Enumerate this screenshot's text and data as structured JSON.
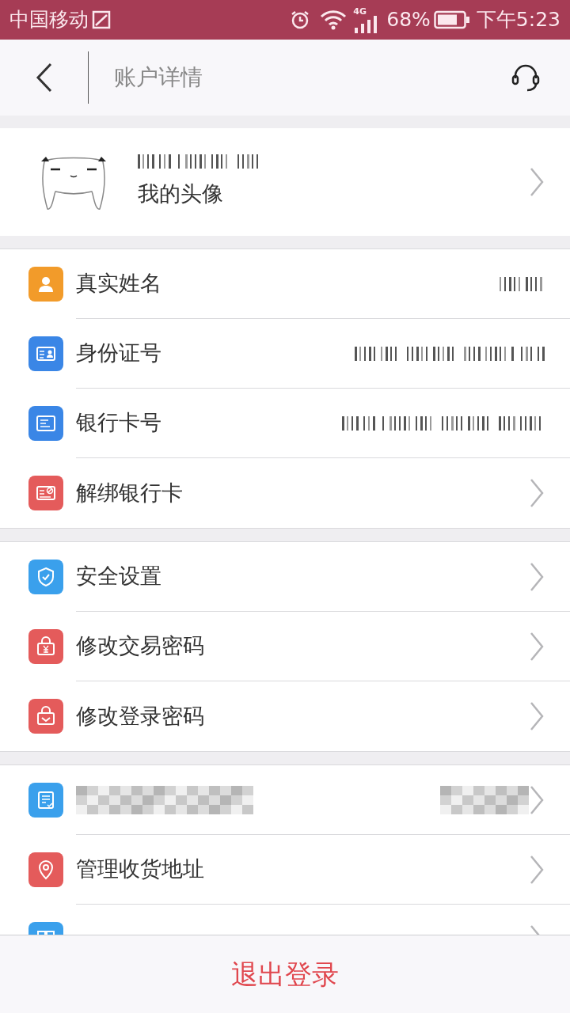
{
  "status_bar": {
    "carrier": "中国移动",
    "network": "4G",
    "battery": "68%",
    "time": "下午5:23"
  },
  "header": {
    "title": "账户详情"
  },
  "profile": {
    "label": "我的头像"
  },
  "sections": [
    {
      "rows": [
        {
          "kind": "redacted",
          "color": "#f29b2a",
          "label": "真实姓名"
        },
        {
          "kind": "redacted",
          "color": "#3a86e6",
          "label": "身份证号"
        },
        {
          "kind": "redacted",
          "color": "#3a86e6",
          "label": "银行卡号"
        },
        {
          "kind": "link",
          "color": "#e45b5b",
          "label": "解绑银行卡"
        }
      ]
    },
    {
      "rows": [
        {
          "kind": "link",
          "color": "#3aa0ec",
          "label": "安全设置"
        },
        {
          "kind": "link",
          "color": "#e45b5b",
          "label": "修改交易密码"
        },
        {
          "kind": "link",
          "color": "#e45b5b",
          "label": "修改登录密码"
        }
      ]
    },
    {
      "rows": [
        {
          "kind": "pixelated",
          "color": "#3aa0ec"
        },
        {
          "kind": "link",
          "color": "#e45b5b",
          "label": "管理收货地址"
        },
        {
          "kind": "cut",
          "color": "#3aa0ec"
        }
      ]
    }
  ],
  "logout": "退出登录"
}
